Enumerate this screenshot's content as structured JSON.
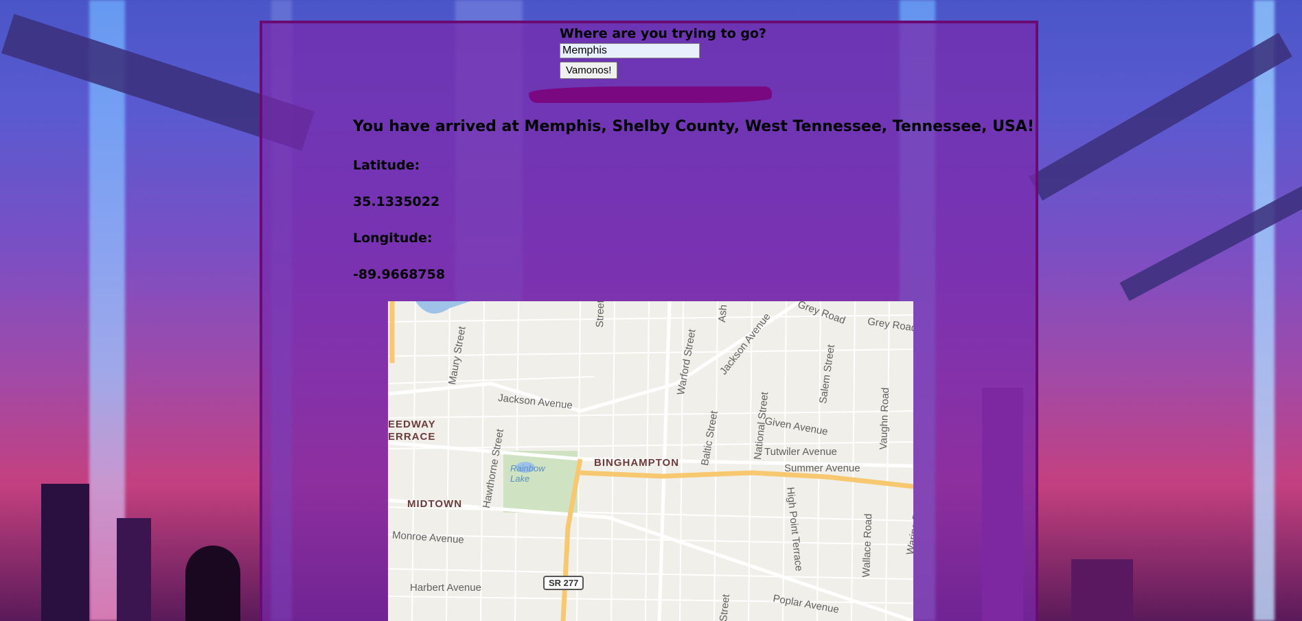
{
  "form": {
    "question": "Where are you trying to go?",
    "input_value": "Memphis",
    "button_label": "Vamonos!"
  },
  "result": {
    "arrived_text": "You have arrived at Memphis, Shelby County, West Tennessee, Tennessee, USA!",
    "latitude_label": "Latitude:",
    "latitude_value": "35.1335022",
    "longitude_label": "Longitude:",
    "longitude_value": "-89.9668758"
  },
  "map": {
    "streets": [
      "Jackson Avenue",
      "Maury Street",
      "Hawthorne Street",
      "Warford Street",
      "Jackson Avenue",
      "Grey Road",
      "Grey Road",
      "Salem Street",
      "Vaughn Road",
      "National Street",
      "Baltic Street",
      "Given Avenue",
      "Tutwiler Avenue",
      "Summer Avenue",
      "High Point Terrace",
      "Wallace Road",
      "Waring Road",
      "Monroe Avenue",
      "Harbert Avenue",
      "Poplar Avenue",
      "Street",
      "Street",
      "Ash"
    ],
    "areas": [
      "BINGHAMPTON",
      "MIDTOWN",
      "EEDWAY",
      "ERRACE"
    ],
    "park": "Rainbow Lake",
    "shield": "SR 277"
  },
  "colors": {
    "panel_border": "#6a0a72",
    "brush": "#7a0880",
    "map_major_road": "#f7c870",
    "map_park": "#cfe3c3"
  }
}
